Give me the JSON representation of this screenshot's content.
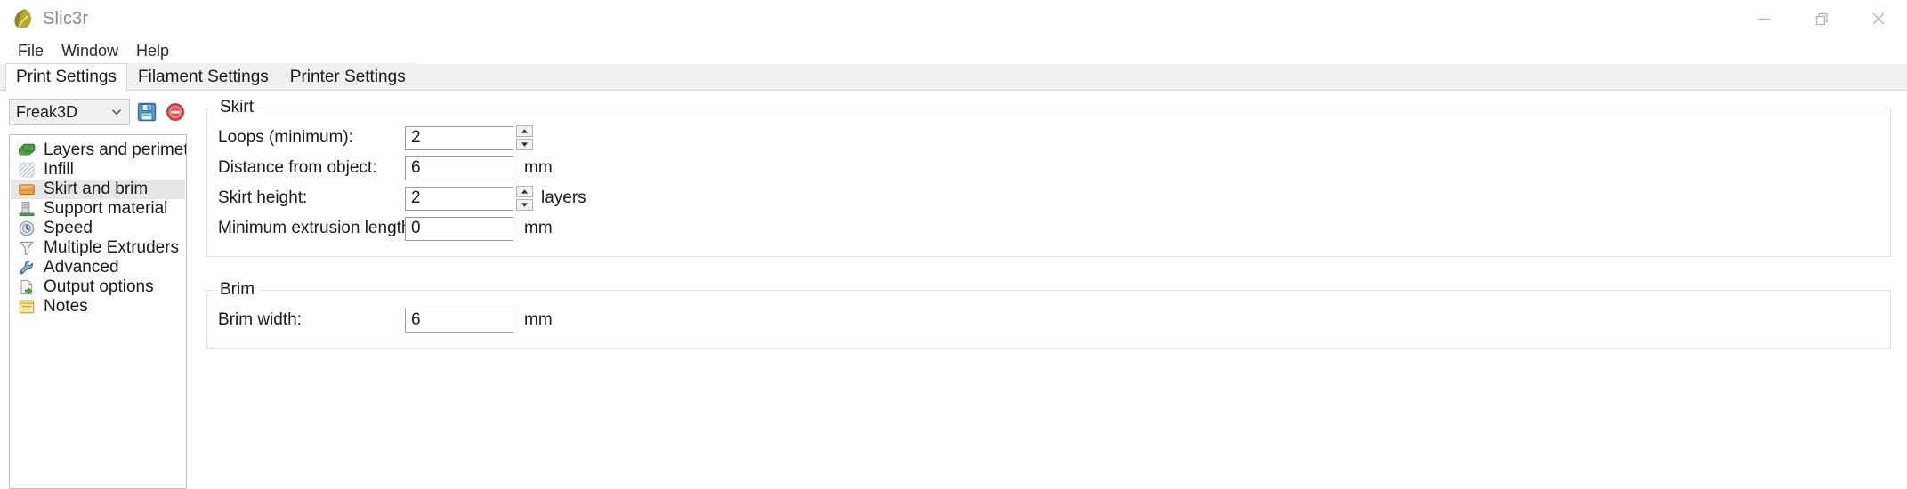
{
  "window": {
    "title": "Slic3r",
    "logo_icon": "slic3r-leaf-icon",
    "controls": [
      {
        "name": "minimize",
        "icon": "minimize-icon"
      },
      {
        "name": "restore",
        "icon": "restore-icon"
      },
      {
        "name": "close",
        "icon": "close-icon"
      }
    ]
  },
  "menu": {
    "items": [
      {
        "label": "File"
      },
      {
        "label": "Window"
      },
      {
        "label": "Help"
      }
    ]
  },
  "tabs": [
    {
      "label": "Print Settings",
      "active": true
    },
    {
      "label": "Filament Settings",
      "active": false
    },
    {
      "label": "Printer Settings",
      "active": false
    }
  ],
  "preset": {
    "value": "Freak3D",
    "caret_icon": "chevron-down-icon",
    "save_icon": "floppy-disk-save-icon",
    "delete_icon": "remove-circle-icon"
  },
  "sidebar": {
    "items": [
      {
        "label": "Layers and perimeters",
        "icon": "layers-icon",
        "selected": false
      },
      {
        "label": "Infill",
        "icon": "infill-hatch-icon",
        "selected": false
      },
      {
        "label": "Skirt and brim",
        "icon": "skirt-box-icon",
        "selected": true
      },
      {
        "label": "Support material",
        "icon": "support-material-icon",
        "selected": false
      },
      {
        "label": "Speed",
        "icon": "speed-clock-icon",
        "selected": false
      },
      {
        "label": "Multiple Extruders",
        "icon": "funnel-icon",
        "selected": false
      },
      {
        "label": "Advanced",
        "icon": "wrench-icon",
        "selected": false
      },
      {
        "label": "Output options",
        "icon": "output-document-icon",
        "selected": false
      },
      {
        "label": "Notes",
        "icon": "notes-icon",
        "selected": false
      }
    ]
  },
  "groups": [
    {
      "title": "Skirt",
      "rows": [
        {
          "label": "Loops (minimum):",
          "value": "2",
          "unit": "",
          "spinner": true
        },
        {
          "label": "Distance from object:",
          "value": "6",
          "unit": "mm",
          "spinner": false
        },
        {
          "label": "Skirt height:",
          "value": "2",
          "unit": "layers",
          "spinner": true
        },
        {
          "label": "Minimum extrusion length:",
          "value": "0",
          "unit": "mm",
          "spinner": false
        }
      ]
    },
    {
      "title": "Brim",
      "rows": [
        {
          "label": "Brim width:",
          "value": "6",
          "unit": "mm",
          "spinner": false
        }
      ]
    }
  ],
  "colors": {
    "titlebar_text": "#8a8a8a",
    "tabstrip_bg": "#f0f0f0",
    "selection_bg": "#e6e6e6",
    "group_border": "#e0e0e0",
    "field_border": "#9a9a9a",
    "logo_olive": "#a8a033",
    "save_blue": "#3f7fc4",
    "delete_red": "#e24a44",
    "layers_green": "#4aa14a",
    "skirt_orange": "#e08a33"
  }
}
